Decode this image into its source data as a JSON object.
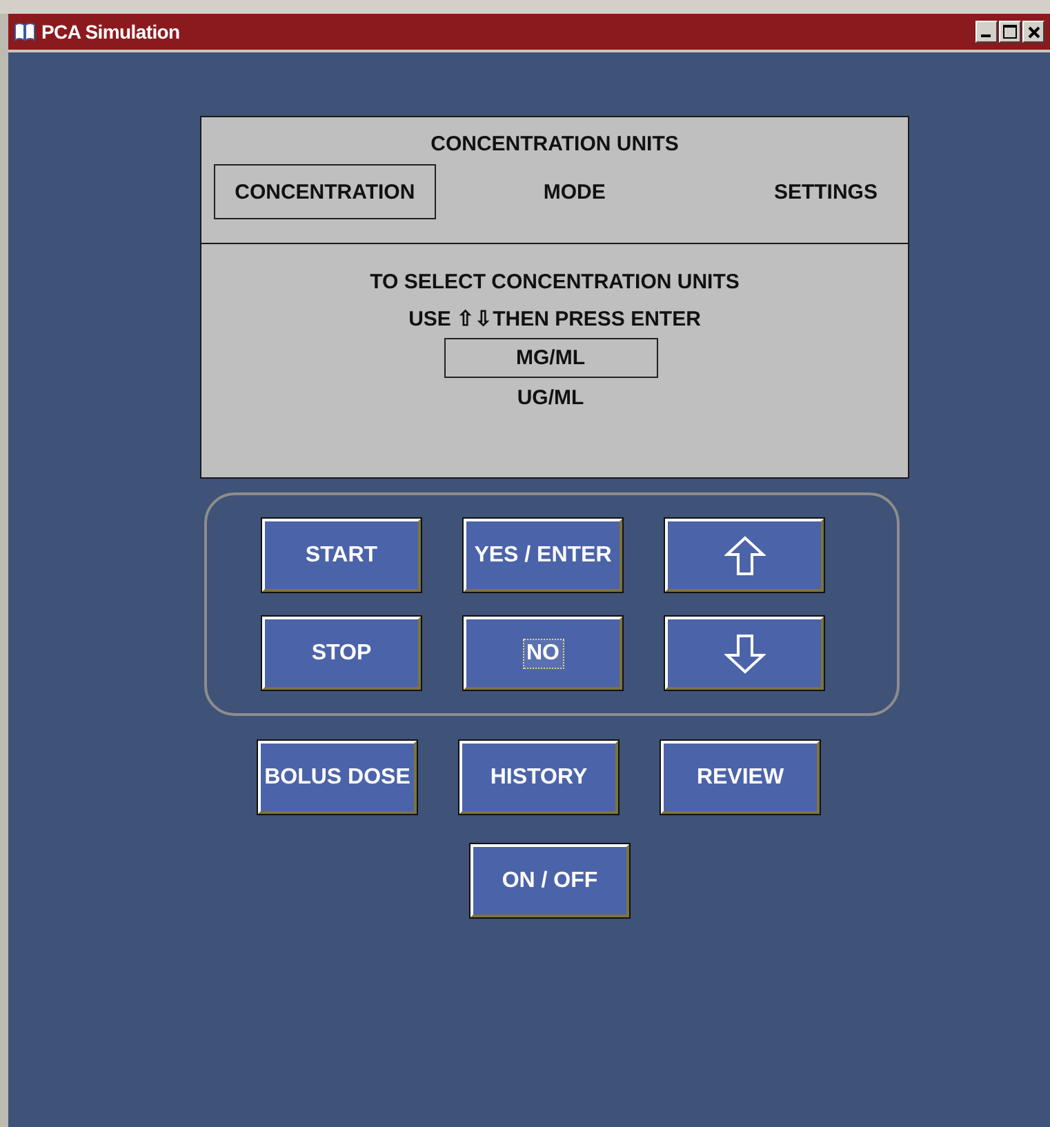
{
  "window": {
    "title": "PCA Simulation"
  },
  "display": {
    "heading": "CONCENTRATION UNITS",
    "tabs": [
      {
        "label": "CONCENTRATION",
        "selected": true
      },
      {
        "label": "MODE",
        "selected": false
      },
      {
        "label": "SETTINGS",
        "selected": false
      }
    ],
    "instructions": [
      "TO SELECT CONCENTRATION UNITS",
      "USE ⇧⇩THEN PRESS ENTER"
    ],
    "options": [
      {
        "label": "MG/ML",
        "selected": true
      },
      {
        "label": "UG/ML",
        "selected": false
      }
    ]
  },
  "keypad": [
    {
      "kind": "text",
      "label": "START",
      "focused": false
    },
    {
      "kind": "text",
      "label": "YES / ENTER",
      "focused": false
    },
    {
      "kind": "up",
      "focused": false
    },
    {
      "kind": "text",
      "label": "STOP",
      "focused": false
    },
    {
      "kind": "text",
      "label": "NO",
      "focused": true
    },
    {
      "kind": "down",
      "focused": false
    }
  ],
  "function_buttons": [
    {
      "label": "BOLUS DOSE"
    },
    {
      "label": "HISTORY"
    },
    {
      "label": "REVIEW"
    }
  ],
  "power_button": {
    "label": "ON / OFF"
  }
}
